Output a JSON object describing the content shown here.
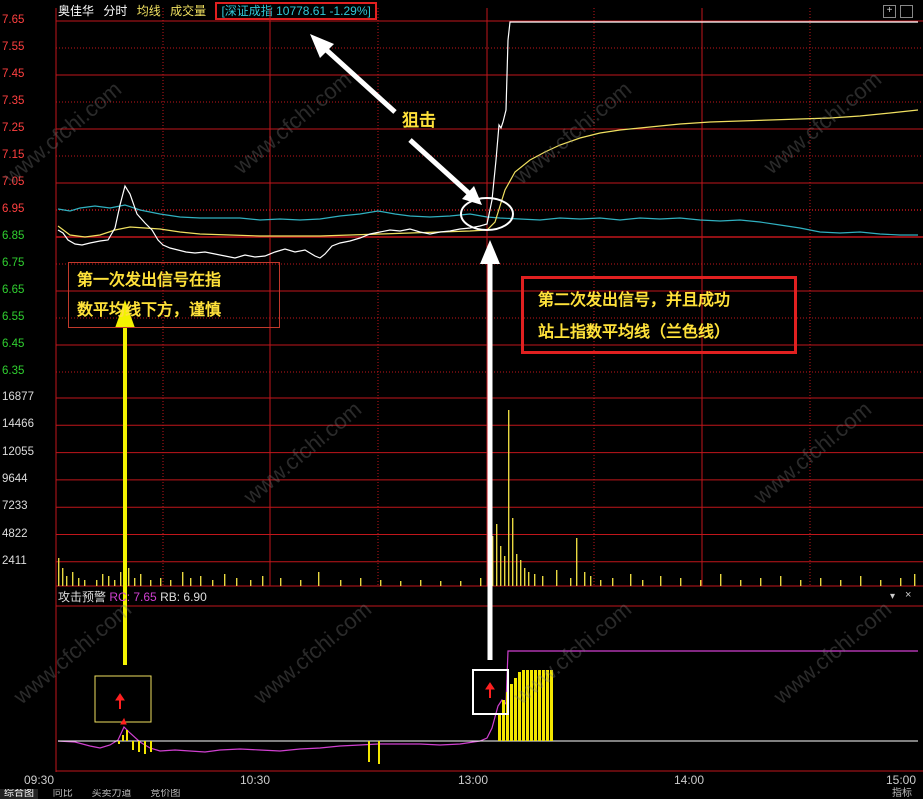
{
  "header": {
    "stock_name": "奥佳华",
    "tab_timeshare": "分时",
    "tab_avg": "均线",
    "tab_volume": "成交量",
    "index_label": "[深证成指 10778.61 -1.29%]"
  },
  "price_axis": [
    "7.65",
    "7.55",
    "7.45",
    "7.35",
    "7.25",
    "7.15",
    "7.05",
    "6.95",
    "6.85",
    "6.75",
    "6.65",
    "6.55",
    "6.45",
    "6.35"
  ],
  "volume_axis": [
    "16877",
    "14466",
    "12055",
    "9644",
    "7233",
    "4822",
    "2411"
  ],
  "sub_indicator": {
    "name": "攻击预警",
    "rc_label": "RC: 7.65",
    "rb_label": "RB: 6.90"
  },
  "time_axis": [
    "09:30",
    "10:30",
    "13:00",
    "14:00",
    "15:00"
  ],
  "annotations": {
    "snipe": "狙击",
    "first_signal_line1": "第一次发出信号在指",
    "first_signal_line2": "数平均线下方，谨慎",
    "second_signal_line1": "第二次发出信号，并且成功",
    "second_signal_line2": "站上指数平均线（兰色线）"
  },
  "bottom_tabs": [
    "综合图",
    "同比",
    "买卖力道",
    "竞价图"
  ],
  "bottom_right": "指标",
  "watermark": "www.cfchi.com",
  "colors": {
    "grid": "#c0161b",
    "price_line": "#ffffff",
    "avg_line": "#f0e060",
    "index_line": "#30b0c0",
    "volume": "#e8d840",
    "signal_line": "#d040d0",
    "arrow_yellow": "#f2f200",
    "annotation_text": "#ffe23a"
  }
}
